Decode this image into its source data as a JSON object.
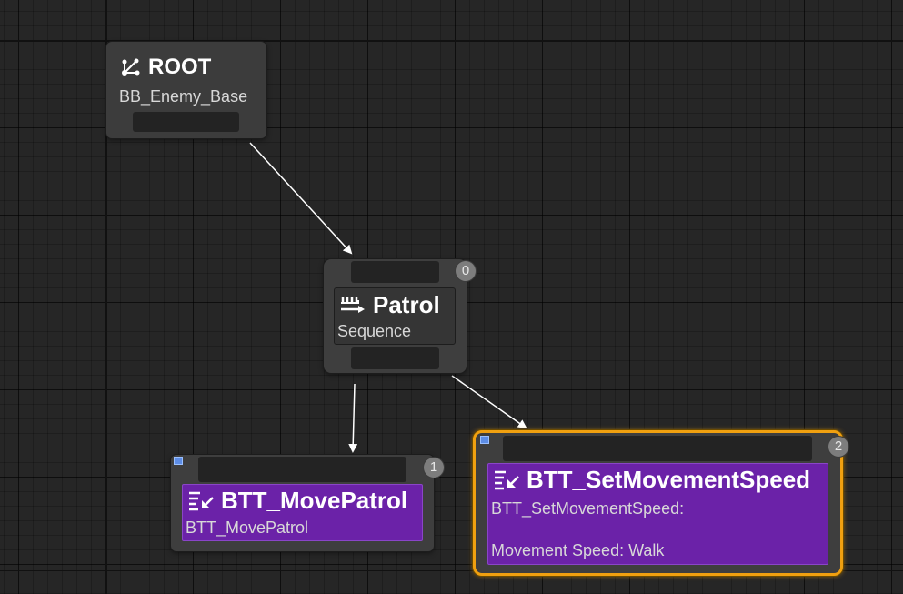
{
  "root_node": {
    "title": "ROOT",
    "blackboard": "BB_Enemy_Base",
    "icon": "root-tree-icon"
  },
  "patrol_node": {
    "title": "Patrol",
    "type": "Sequence",
    "index": "0",
    "icon": "sequence-icon"
  },
  "move_task_node": {
    "title": "BTT_MovePatrol",
    "description": "BTT_MovePatrol",
    "index": "1",
    "icon": "task-icon"
  },
  "speed_task_node": {
    "title": "BTT_SetMovementSpeed",
    "description_line1": "BTT_SetMovementSpeed:",
    "description_line2": "Movement Speed: Walk",
    "index": "2",
    "icon": "task-icon",
    "selected": true
  },
  "colors": {
    "canvas": "#262626",
    "task_purple": "#6b22a8",
    "selection_orange": "#f0a010",
    "node_gray": "#3e3e3e"
  }
}
